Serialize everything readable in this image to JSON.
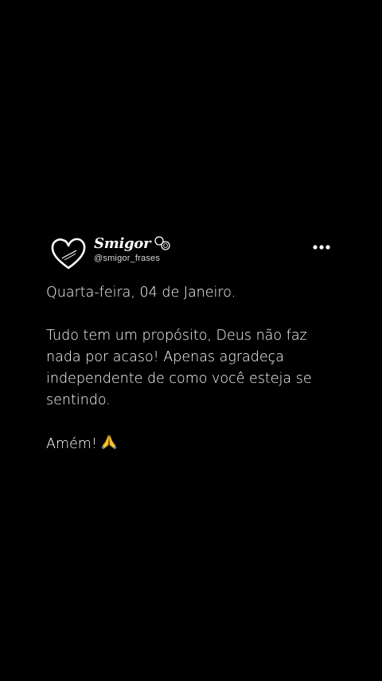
{
  "profile": {
    "display_name": "Smigor",
    "handle": "@smigor_frases",
    "logo_icon": "heart-logo-icon",
    "badge_icon": "linked-rings-icon"
  },
  "menu": {
    "icon": "more-horizontal-icon"
  },
  "post": {
    "date_line": "Quarta-feira, 04 de Janeiro.",
    "message": "Tudo tem um propósito, Deus não faz nada por acaso! Apenas agradeça independente de como você esteja se sentindo.",
    "closing": "Amém!",
    "closing_emoji": "praying-hands-icon"
  },
  "colors": {
    "background": "#000000",
    "text": "#ffffff",
    "handle": "#d8d8d8"
  }
}
